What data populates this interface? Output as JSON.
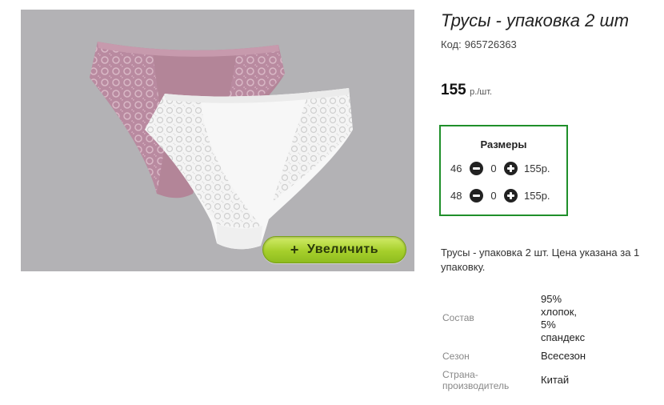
{
  "product": {
    "title": "Трусы - упаковка 2 шт",
    "code_label": "Код:",
    "code_value": "965726363",
    "price_amount": "155",
    "price_unit": "р./шт.",
    "zoom_label": "Увеличить",
    "zoom_plus": "+"
  },
  "sizes": {
    "title": "Размеры",
    "rows": [
      {
        "size": "46",
        "qty": "0",
        "price": "155р."
      },
      {
        "size": "48",
        "qty": "0",
        "price": "155р."
      }
    ]
  },
  "description": "Трусы - упаковка 2 шт. Цена указана за 1 упаковку.",
  "attributes": {
    "composition_label": "Состав",
    "composition_value_lines": [
      "95%",
      "хлопок,",
      "5%",
      "спандекс"
    ],
    "season_label": "Сезон",
    "season_value": "Всесезон",
    "country_label_lines": [
      "Страна-",
      "производитель"
    ],
    "country_value": "Китай"
  },
  "colors": {
    "accent_green": "#1f8f2a",
    "button_green": "#a6cf2b",
    "photo_background": "#b3b2b5"
  }
}
